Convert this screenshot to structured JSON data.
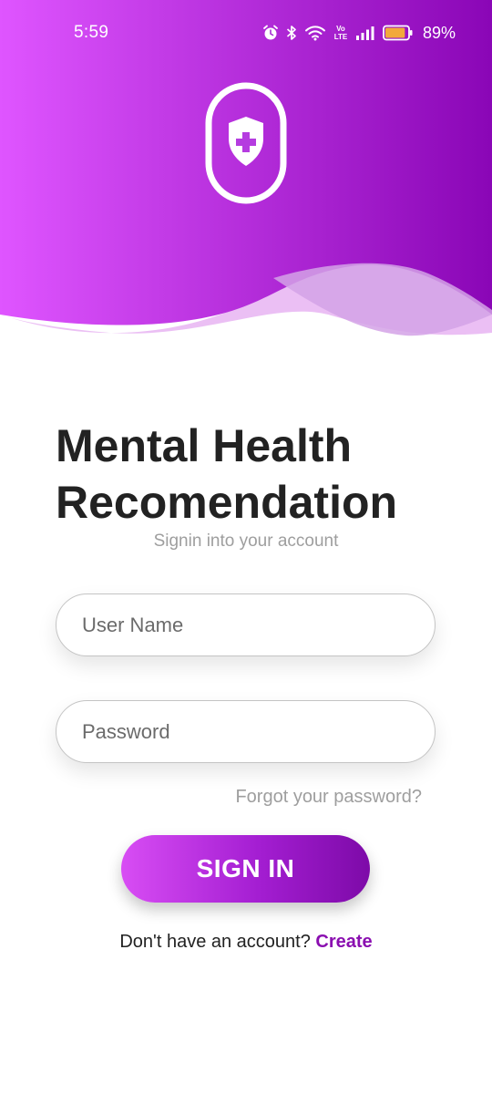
{
  "status_bar": {
    "time": "5:59",
    "icons": [
      "alarm-icon",
      "bluetooth-icon",
      "wifi-icon",
      "volte-icon",
      "signal-icon",
      "battery-icon"
    ],
    "volte_text": "Vo LTE",
    "battery_percent": "89%",
    "battery_level": 0.89
  },
  "header": {
    "gradient_start": "#df55ff",
    "gradient_end": "#8a06b6",
    "logo_icon": "shield-cross-icon"
  },
  "login": {
    "title": "Mental Health Recomendation",
    "subtitle": "Signin into your account",
    "username_placeholder": "User Name",
    "password_placeholder": "Password",
    "forgot_label": "Forgot your password?",
    "signin_label": "SIGN IN",
    "no_account_text": "Don't have an account?",
    "create_label": "Create"
  },
  "colors": {
    "accent": "#8a0eb0",
    "title_text": "#222222",
    "muted_text": "#9e9e9e"
  }
}
